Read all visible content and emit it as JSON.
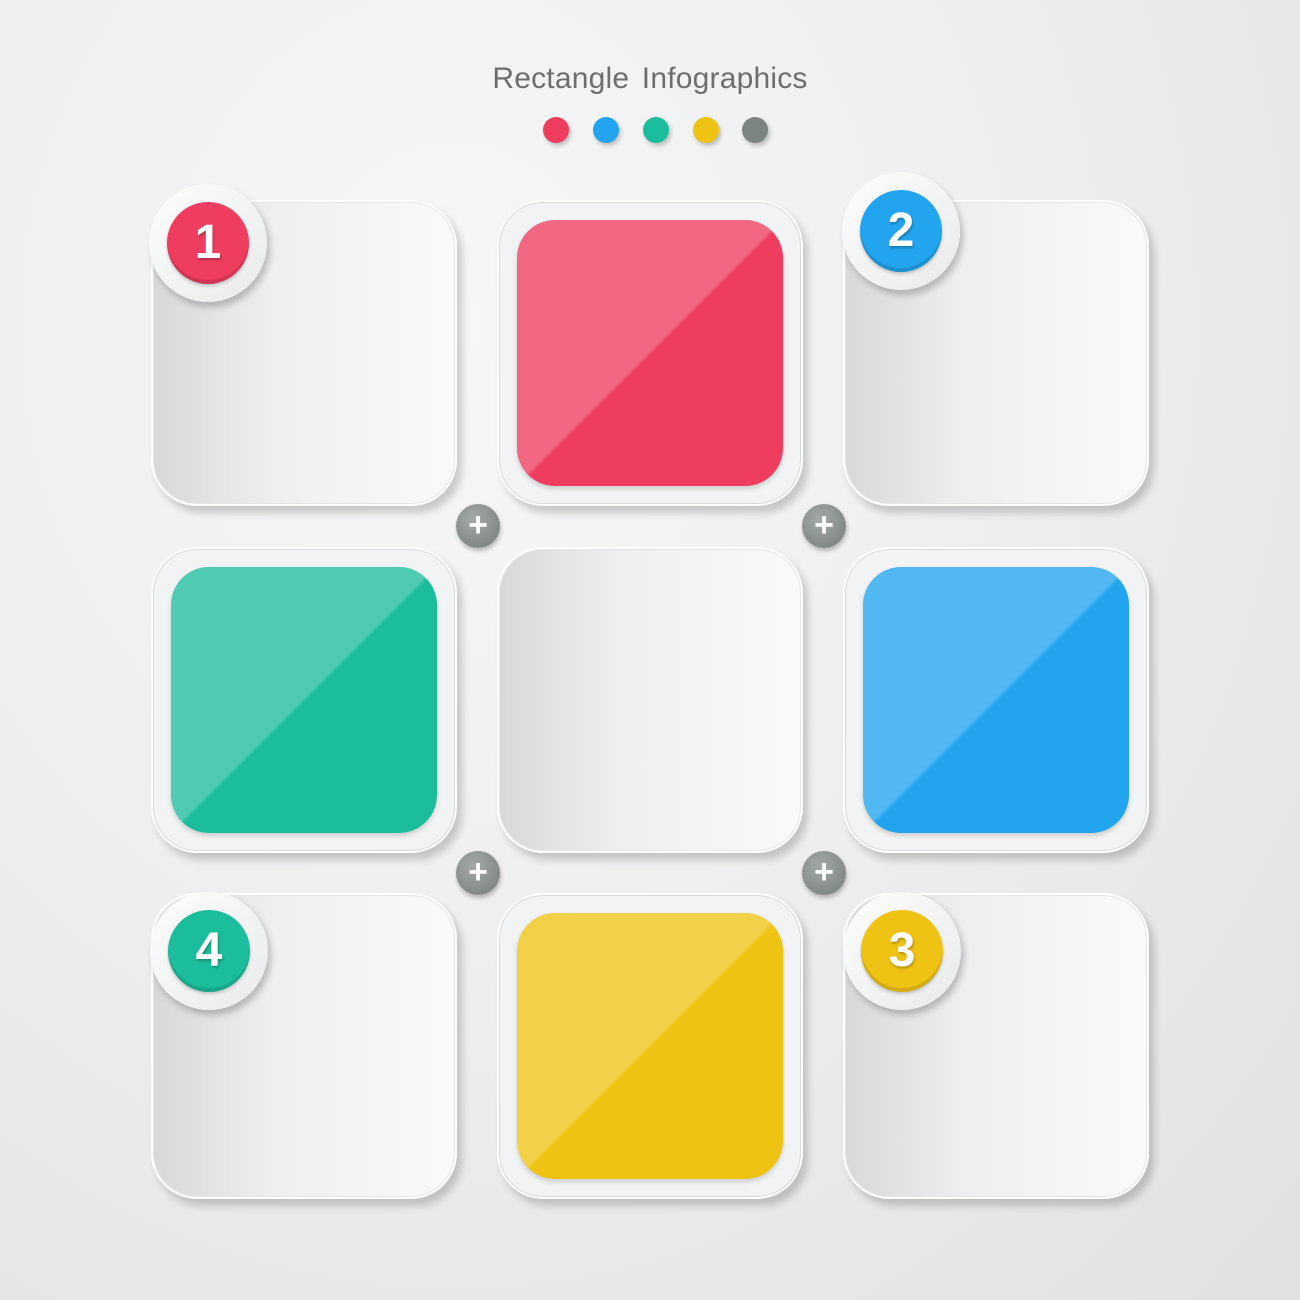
{
  "title": "Rectangle Infographics",
  "palette": {
    "red": "#ef3d5f",
    "blue": "#22a4ee",
    "green": "#1cbd9c",
    "yellow": "#efc314",
    "gray": "#7c8483"
  },
  "dots": [
    {
      "name": "red-dot",
      "color": "#ef3d5f"
    },
    {
      "name": "blue-dot",
      "color": "#22a4ee"
    },
    {
      "name": "green-dot",
      "color": "#1cbd9c"
    },
    {
      "name": "yellow-dot",
      "color": "#efc314"
    },
    {
      "name": "gray-dot",
      "color": "#7c8483"
    }
  ],
  "badges": [
    {
      "label": "1",
      "color": "#ef3d5f"
    },
    {
      "label": "2",
      "color": "#22a4ee"
    },
    {
      "label": "3",
      "color": "#efc314"
    },
    {
      "label": "4",
      "color": "#1cbd9c"
    }
  ],
  "connector_symbol": "+",
  "connector_icon": "plus-icon"
}
